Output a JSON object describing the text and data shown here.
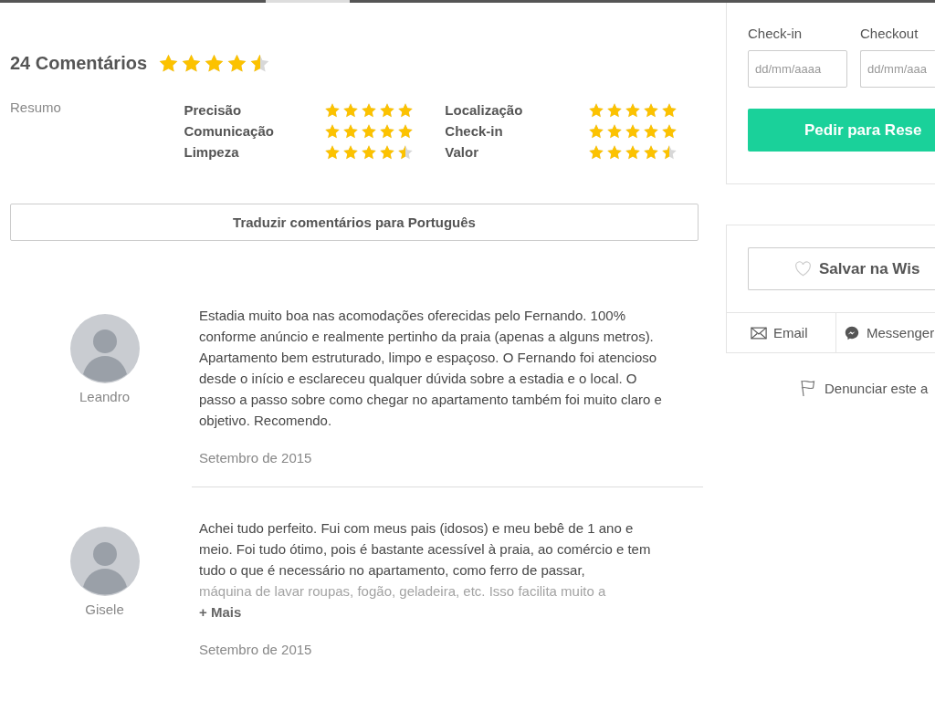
{
  "reviews_summary": {
    "title": "24 Comentários",
    "stars": 4.5,
    "summary_label": "Resumo",
    "category_columns": [
      [
        {
          "label": "Precisão",
          "stars": 5
        },
        {
          "label": "Comunicação",
          "stars": 5
        },
        {
          "label": "Limpeza",
          "stars": 4.5
        }
      ],
      [
        {
          "label": "Localização",
          "stars": 5
        },
        {
          "label": "Check-in",
          "stars": 5
        },
        {
          "label": "Valor",
          "stars": 4.5
        }
      ]
    ]
  },
  "translate_button": "Traduzir comentários para Português",
  "reviews": [
    {
      "author": "Leandro",
      "text": "Estadia muito boa nas acomodações oferecidas pelo Fernando. 100% conforme anúncio e realmente pertinho da praia (apenas a alguns metros). Apartamento bem estruturado, limpo e espaçoso. O Fernando foi atencioso desde o início e esclareceu qualquer dúvida sobre a estadia e o local. O passo a passo sobre como chegar no apartamento também foi muito claro e objetivo. Recomendo.",
      "date": "Setembro de 2015"
    },
    {
      "author": "Gisele",
      "text": "Achei tudo perfeito. Fui com meus pais (idosos) e meu bebê de 1 ano e meio. Foi tudo ótimo, pois é bastante acessível à praia, ao comércio e tem tudo o que é necessário no apartamento, como ferro de passar,",
      "faded_text": "máquina de lavar roupas, fogão, geladeira, etc. Isso facilita muito a",
      "more_link": "+ Mais",
      "date": "Setembro de 2015"
    }
  ],
  "booking": {
    "checkin_label": "Check-in",
    "checkout_label": "Checkout",
    "checkin_placeholder": "dd/mm/aaaa",
    "checkout_placeholder": "dd/mm/aaa",
    "request_button": "Pedir para Rese"
  },
  "share": {
    "wishlist_button": "Salvar na Wis",
    "email": "Email",
    "messenger": "Messenger",
    "report_link": "Denunciar este a"
  }
}
